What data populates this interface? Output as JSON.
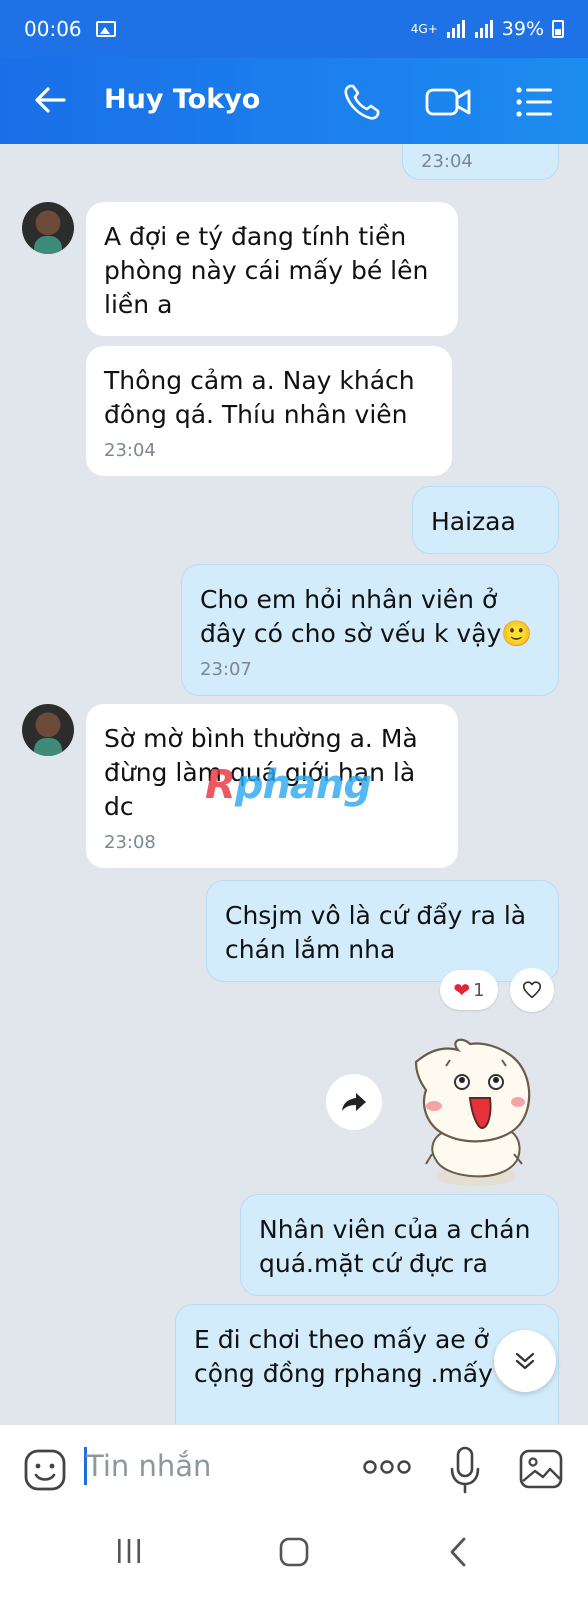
{
  "status_bar": {
    "time": "00:06",
    "network": "4G+",
    "battery": "39%"
  },
  "header": {
    "title": "Huy Tokyo"
  },
  "messages": [
    {
      "dir": "out",
      "text": "",
      "time": "23:04"
    },
    {
      "dir": "in",
      "text": "A đợi e tý đang tính tiền phòng này cái mấy bé lên liền a",
      "time": ""
    },
    {
      "dir": "in",
      "text": "Thông cảm a. Nay khách đông qá. Thíu nhân viên",
      "time": "23:04"
    },
    {
      "dir": "out",
      "text": "Haizaa",
      "time": ""
    },
    {
      "dir": "out",
      "text": "Cho em hỏi nhân viên ở đây có cho sờ vếu k vậy🙂",
      "time": "23:07"
    },
    {
      "dir": "in",
      "text": "Sờ mờ bình thường a. Mà đừng làm quá giới hạn là dc",
      "time": "23:08"
    },
    {
      "dir": "out",
      "text": "Chsjm vô là cứ đẩy ra là chán lắm nha",
      "time": "",
      "reaction_count": "1"
    },
    {
      "dir": "out",
      "text": "Nhân viên của a chán quá.mặt cứ đực ra",
      "time": ""
    },
    {
      "dir": "out",
      "text": "E đi chơi theo mấy ae ở cộng đồng rphang .mấy ae",
      "time": ""
    }
  ],
  "watermark": {
    "r": "R",
    "rest": "phang"
  },
  "input": {
    "placeholder": "Tin nhắn"
  },
  "colors": {
    "primary": "#1e72e6",
    "incoming_bubble": "#ffffff",
    "outgoing_bubble": "#d3ecfb",
    "background": "#e1e6ec"
  },
  "icons": [
    "back-arrow-icon",
    "phone-icon",
    "video-call-icon",
    "menu-icon",
    "sticker-face-icon",
    "more-icon",
    "microphone-icon",
    "image-icon",
    "forward-icon",
    "chevron-down-icon",
    "heart-icon"
  ]
}
